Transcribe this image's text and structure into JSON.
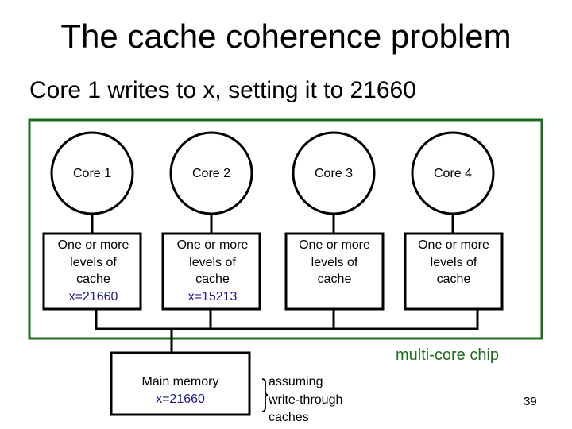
{
  "slide": {
    "title": "The cache coherence problem",
    "subtitle": "Core 1 writes to x, setting it to 21660",
    "page_number": "39"
  },
  "chip": {
    "label": "multi-core chip",
    "border_color": "#1e6b1e"
  },
  "cores": [
    {
      "label": "Core 1",
      "cache_text": [
        "One or more",
        "levels of",
        "cache"
      ],
      "cache_value": "x=21660"
    },
    {
      "label": "Core 2",
      "cache_text": [
        "One or more",
        "levels of",
        "cache"
      ],
      "cache_value": "x=15213"
    },
    {
      "label": "Core 3",
      "cache_text": [
        "One or more",
        "levels of",
        "cache"
      ],
      "cache_value": ""
    },
    {
      "label": "Core 4",
      "cache_text": [
        "One or more",
        "levels of",
        "cache"
      ],
      "cache_value": ""
    }
  ],
  "memory": {
    "label": "Main memory",
    "value": "x=21660"
  },
  "note": {
    "lines": [
      "assuming",
      "write-through",
      "caches"
    ]
  },
  "colors": {
    "value_text": "#1a1a8c",
    "chip_green": "#1e6b1e"
  }
}
